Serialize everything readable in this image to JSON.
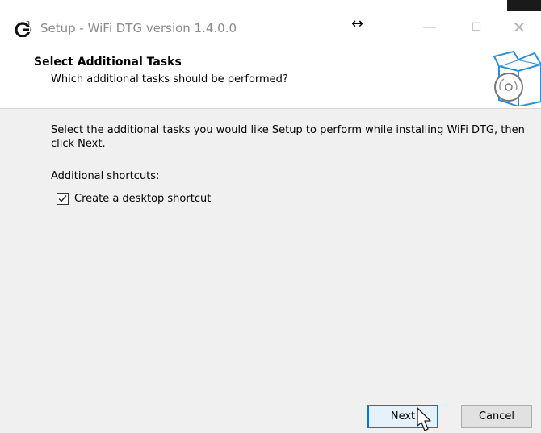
{
  "window": {
    "title": "Setup - WiFi DTG version 1.4.0.0",
    "icons": {
      "app": "wifi-dtg-app-icon",
      "resize": "resize-arrows-icon",
      "minimize": "minimize-icon",
      "maximize": "maximize-icon",
      "close": "close-icon"
    },
    "resize_glyph": "↔",
    "minimize_glyph": "—",
    "maximize_glyph": "☐",
    "close_glyph": "✕"
  },
  "header": {
    "title": "Select Additional Tasks",
    "subtitle": "Which additional tasks should be performed?",
    "icon": "setup-box-disc-icon"
  },
  "content": {
    "description": "Select the additional tasks you would like Setup to perform while installing WiFi DTG, then click Next.",
    "shortcuts_label": "Additional shortcuts:",
    "tasks": [
      {
        "label": "Create a desktop shortcut",
        "checked": true
      }
    ]
  },
  "footer": {
    "next_label": "Next",
    "cancel_label": "Cancel"
  },
  "colors": {
    "accent": "#0078d7",
    "panel": "#f0f0f0",
    "title_text": "#8a8a8a"
  }
}
